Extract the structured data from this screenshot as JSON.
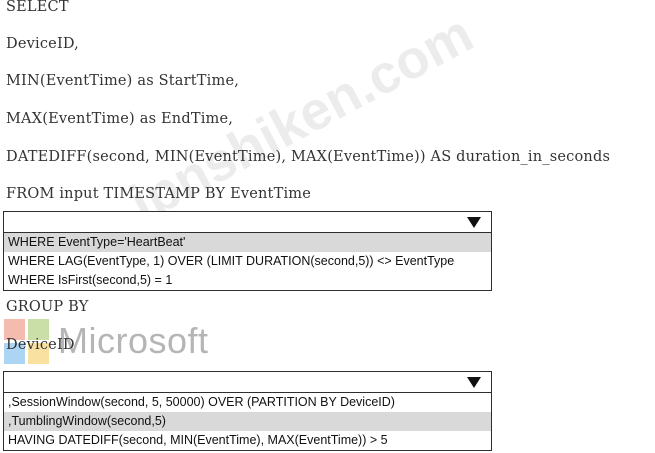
{
  "query": {
    "lines": [
      "SELECT",
      "DeviceID,",
      "MIN(EventTime) as StartTime,",
      "MAX(EventTime) as EndTime,",
      "DATEDIFF(second, MIN(EventTime), MAX(EventTime)) AS duration_in_seconds",
      "FROM input TIMESTAMP BY EventTime"
    ],
    "group_by": "GROUP BY",
    "device_id": "DeviceID"
  },
  "dropdown1": {
    "selected_index": 0,
    "options": [
      "WHERE EventType='HeartBeat'",
      "WHERE LAG(EventType, 1) OVER (LIMIT DURATION(second,5)) <> EventType",
      "WHERE IsFirst(second,5) = 1"
    ]
  },
  "dropdown2": {
    "selected_index": 1,
    "options": [
      ",SessionWindow(second, 5, 50000) OVER (PARTITION BY DeviceID)",
      ",TumblingWindow(second,5)",
      "HAVING DATEDIFF(second, MIN(EventTime), MAX(EventTime)) > 5"
    ]
  },
  "logo": {
    "text": "Microsoft"
  },
  "watermark": {
    "text": "ipnshiken.com"
  }
}
